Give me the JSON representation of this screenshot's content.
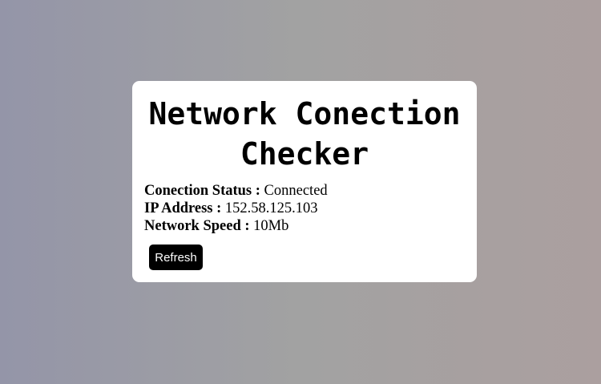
{
  "card": {
    "title": "Network Conection Checker"
  },
  "status": {
    "connection_label": "Conection Status :",
    "connection_value": "Connected",
    "ip_label": "IP Address :",
    "ip_value": "152.58.125.103",
    "speed_label": "Network Speed :",
    "speed_value": "10Mb"
  },
  "actions": {
    "refresh_label": "Refresh"
  },
  "colors": {
    "card_background": "#ffffff",
    "button_background": "#000000",
    "button_text": "#ffffff"
  }
}
